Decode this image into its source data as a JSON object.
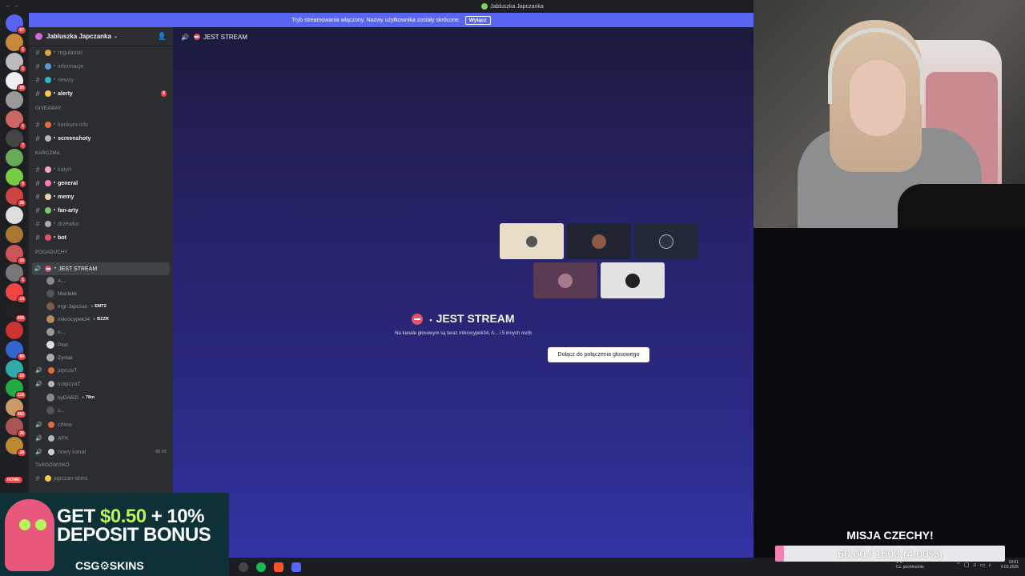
{
  "window": {
    "title": "Jabluszka Japczanka"
  },
  "banner": {
    "text": "Tryb streamowania włączony. Nazwy użytkownika zostały skrócone.",
    "button": "Wyłącz"
  },
  "rail": {
    "badges": [
      "67",
      "1",
      "1",
      "36",
      "",
      "1",
      "7",
      "",
      "9",
      "26",
      "",
      "",
      "20",
      "1",
      "14",
      "206",
      "",
      "80",
      "19",
      "116",
      "682",
      "26",
      "28"
    ],
    "new_label": "NOWE"
  },
  "guild": {
    "name": "Jabluszka Japczanka"
  },
  "channels": [
    {
      "label": "regulamin",
      "type": "text",
      "state": "muted"
    },
    {
      "label": "informacje",
      "type": "text",
      "state": "muted"
    },
    {
      "label": "newsy",
      "type": "text",
      "state": "muted"
    },
    {
      "label": "alerty",
      "type": "text",
      "state": "unread",
      "mention": "6"
    },
    {
      "label": "GIVEAWAY",
      "type": "category"
    },
    {
      "label": "konkurs-info",
      "type": "text",
      "state": "muted"
    },
    {
      "label": "screenshoty",
      "type": "text",
      "state": "unread"
    },
    {
      "label": "KARCZMA",
      "type": "category"
    },
    {
      "label": "katyń",
      "type": "text",
      "state": "muted"
    },
    {
      "label": "general",
      "type": "text",
      "state": "unread"
    },
    {
      "label": "memy",
      "type": "text",
      "state": "unread"
    },
    {
      "label": "fan-arty",
      "type": "text",
      "state": "unread"
    },
    {
      "label": "drzewko",
      "type": "text",
      "state": "muted"
    },
    {
      "label": "bot",
      "type": "text",
      "state": "unread"
    },
    {
      "label": "POGADUCHY",
      "type": "category"
    },
    {
      "label": "JEST STREAM",
      "type": "voice",
      "state": "active"
    }
  ],
  "voice_users": [
    {
      "name": "A...",
      "tag": ""
    },
    {
      "name": "Manlekk",
      "tag": ""
    },
    {
      "name": "mgr Japczan",
      "tag": "EMT2"
    },
    {
      "name": "mikrocypek34",
      "tag": "BZZR"
    },
    {
      "name": "n...",
      "tag": ""
    },
    {
      "name": "Piotr",
      "tag": ""
    },
    {
      "name": "Zynlak",
      "tag": ""
    }
  ],
  "voice_channels": [
    {
      "label": "japczaT"
    },
    {
      "label": "srapczaT"
    }
  ],
  "voice_users2": [
    {
      "name": "byDABZI",
      "tag": "78m"
    },
    {
      "name": "s...",
      "tag": ""
    }
  ],
  "voice_channels2": [
    {
      "label": "chlew",
      "counter": ""
    },
    {
      "label": "AFK",
      "counter": ""
    },
    {
      "label": "nowy kanał",
      "counter": "00 01"
    }
  ],
  "bottom_channels": [
    {
      "label": "TARGOWISKO",
      "type": "category"
    },
    {
      "label": "japczan-skins",
      "type": "text"
    }
  ],
  "main": {
    "header": "JEST STREAM",
    "vc_title": "JEST STREAM",
    "vc_subtitle": "Na kanale głosowym są teraz mikrocypek34, A... i 5 innych osób",
    "join_button": "Dołącz do połączenia głosowego"
  },
  "ad": {
    "line1_a": "GET ",
    "line1_b": "$0.50",
    "line1_c": " + 10%",
    "line2": "DEPOSIT BONUS",
    "logo": "CSG⚙SKINS"
  },
  "mission": {
    "title": "MISJA CZECHY!",
    "progress_text": "60.00 / 1500 (4.00%)",
    "progress_value": 0.04
  },
  "taskbar": {
    "weather_temp": "1°C",
    "weather_desc": "Cz. pochmurnie",
    "time": "19:01",
    "date": "4.03.2026"
  }
}
